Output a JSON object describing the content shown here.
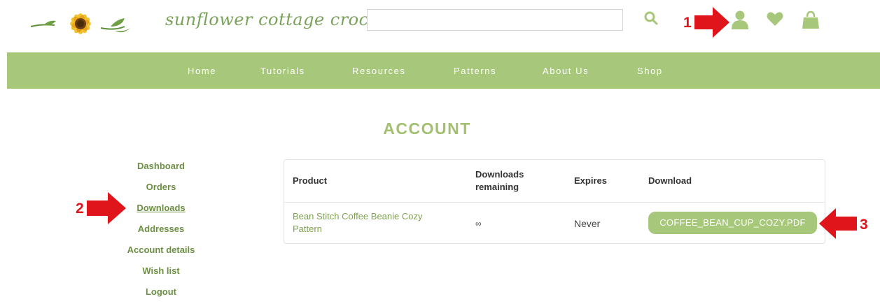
{
  "header": {
    "site_name": "sunflower cottage crochet",
    "search": {
      "value": "",
      "placeholder": ""
    }
  },
  "icons": {
    "search": "search-icon",
    "account": "user-icon",
    "wishlist": "heart-icon",
    "cart": "shopping-bag-icon"
  },
  "colors": {
    "accent": "#a7c77a",
    "link": "#6d8f43",
    "annotation": "#e0141b"
  },
  "nav": [
    "Home",
    "Tutorials",
    "Resources",
    "Patterns",
    "About Us",
    "Shop"
  ],
  "page_title": "ACCOUNT",
  "account_nav": [
    {
      "label": "Dashboard"
    },
    {
      "label": "Orders"
    },
    {
      "label": "Downloads",
      "active": true
    },
    {
      "label": "Addresses"
    },
    {
      "label": "Account details"
    },
    {
      "label": "Wish list"
    },
    {
      "label": "Logout"
    }
  ],
  "downloads_table": {
    "headers": {
      "product": "Product",
      "remaining": "Downloads remaining",
      "expires": "Expires",
      "download": "Download"
    },
    "rows": [
      {
        "product": "Bean Stitch Coffee Beanie Cozy Pattern",
        "remaining": "∞",
        "expires": "Never",
        "file": "COFFEE_BEAN_CUP_COZY.PDF"
      }
    ]
  },
  "annotations": [
    "1",
    "2",
    "3"
  ]
}
